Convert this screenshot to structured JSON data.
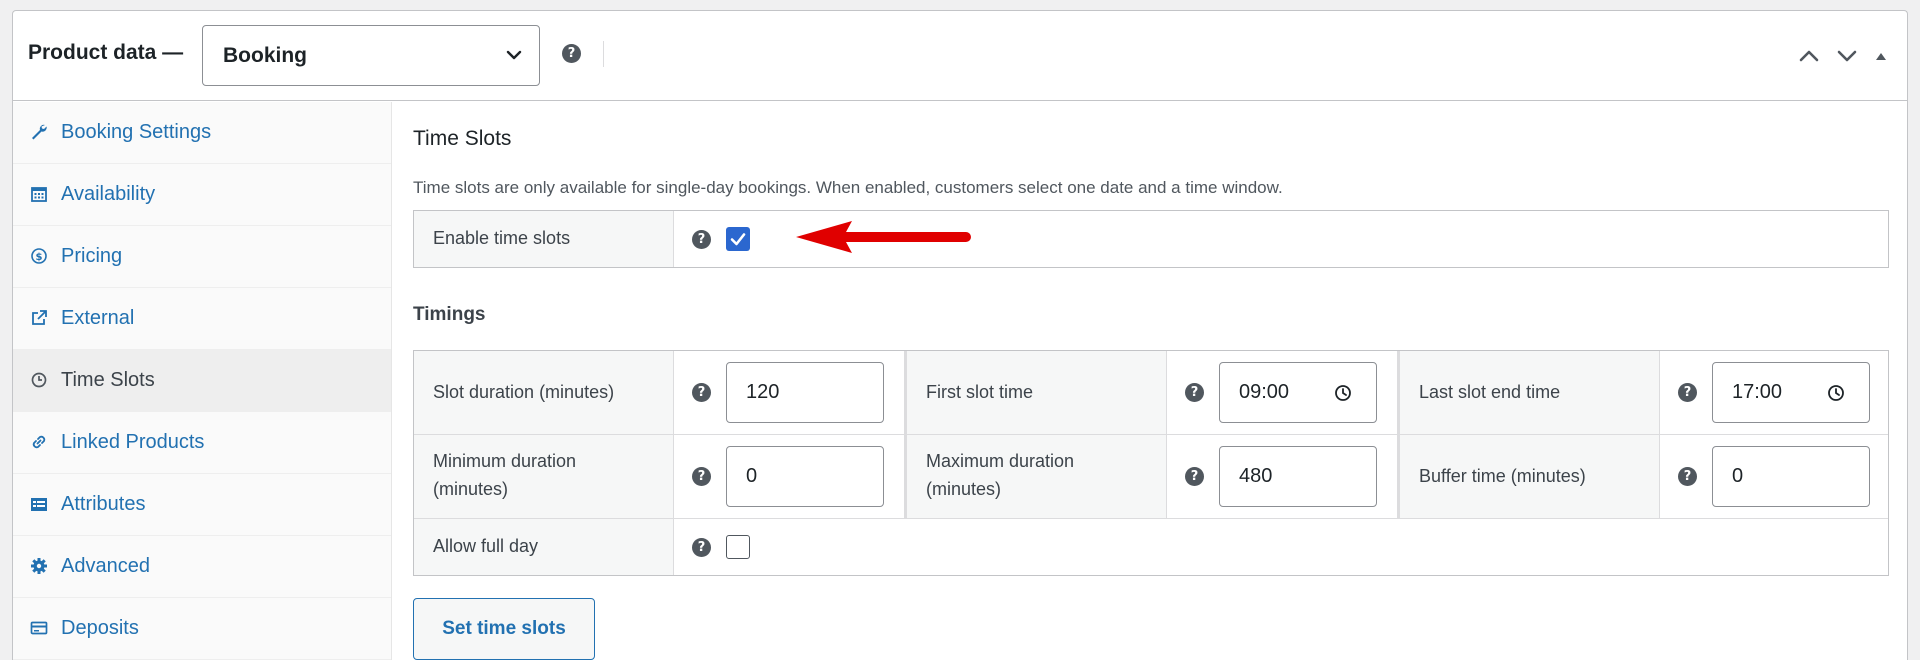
{
  "header": {
    "title": "Product data —",
    "product_type": "Booking",
    "help": "?"
  },
  "sidebar": {
    "items": [
      {
        "label": "Booking Settings",
        "icon": "wrench-icon"
      },
      {
        "label": "Availability",
        "icon": "calendar-icon"
      },
      {
        "label": "Pricing",
        "icon": "dollar-icon"
      },
      {
        "label": "External",
        "icon": "external-link-icon"
      },
      {
        "label": "Time Slots",
        "icon": "clock-icon",
        "active": true
      },
      {
        "label": "Linked Products",
        "icon": "link-icon"
      },
      {
        "label": "Attributes",
        "icon": "list-icon"
      },
      {
        "label": "Advanced",
        "icon": "gear-icon"
      },
      {
        "label": "Deposits",
        "icon": "card-icon"
      }
    ]
  },
  "time_slots": {
    "title": "Time Slots",
    "description": "Time slots are only available for single-day bookings. When enabled, customers select one date and a time window.",
    "enable_label": "Enable time slots",
    "enable_checked": true
  },
  "timings": {
    "title": "Timings",
    "slot_duration": {
      "label": "Slot duration (minutes)",
      "value": "120"
    },
    "first_slot_time": {
      "label": "First slot time",
      "value": "09:00"
    },
    "last_slot_end_time": {
      "label": "Last slot end time",
      "value": "17:00"
    },
    "min_duration": {
      "label_1": "Minimum duration",
      "label_2": "(minutes)",
      "value": "0"
    },
    "max_duration": {
      "label_1": "Maximum duration",
      "label_2": "(minutes)",
      "value": "480"
    },
    "buffer_time": {
      "label": "Buffer time (minutes)",
      "value": "0"
    },
    "allow_full_day": {
      "label": "Allow full day",
      "checked": false
    }
  },
  "actions": {
    "set_time_slots": "Set time slots"
  },
  "colors": {
    "link": "#2271b1",
    "checkbox": "#2b67cf",
    "arrow": "#e00000"
  }
}
